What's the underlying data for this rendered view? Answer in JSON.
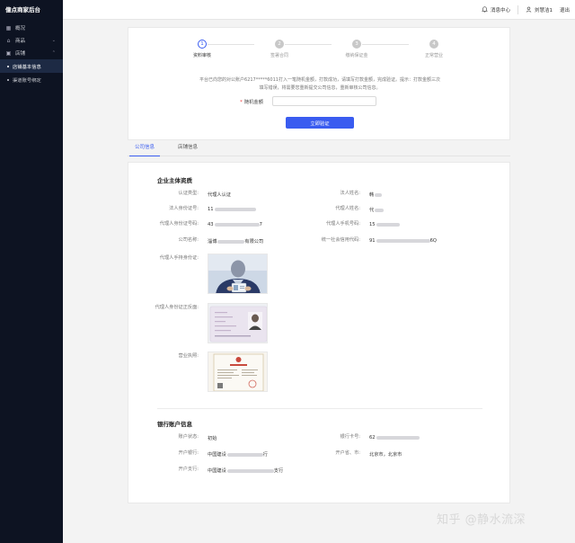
{
  "sidebar": {
    "brand": "億点商家后台",
    "items": [
      {
        "label": "概况",
        "icon": "grid-icon"
      },
      {
        "label": "商品",
        "icon": "home-icon"
      },
      {
        "label": "店铺",
        "icon": "store-icon"
      }
    ],
    "subitems": [
      {
        "label": "店铺基本信息",
        "active": true
      },
      {
        "label": "渠道账号绑定",
        "active": false
      }
    ]
  },
  "header": {
    "messages": "消息中心",
    "user": "刘慧洁1",
    "logout": "退出"
  },
  "steps": [
    {
      "num": "1",
      "label": "资料审核",
      "active": true
    },
    {
      "num": "2",
      "label": "签署合同",
      "active": false
    },
    {
      "num": "3",
      "label": "缴纳保证金",
      "active": false
    },
    {
      "num": "4",
      "label": "正常营业",
      "active": false
    }
  ],
  "notice": {
    "line1": "平台已向您的对公账户6217*****6011打入一笔随机金额，打款成功，请填写打款金额，完成验证。提示：打款金额三次",
    "line2": "填写错误，将需要您重新提交公司信息，重新审核公司信息。"
  },
  "amount": {
    "label": "随机金额",
    "value": ""
  },
  "verify_button": "立即验证",
  "tabs": [
    "公司信息",
    "店铺信息"
  ],
  "company": {
    "title": "企业主体资质",
    "auth_type_label": "认证类型:",
    "auth_type": "代理人认证",
    "legal_name_label": "法人姓名:",
    "legal_name": "韩",
    "legal_id_label": "法人身份证号:",
    "legal_id": "11",
    "agent_name_label": "代理人姓名:",
    "agent_name": "代",
    "agent_id_label": "代理人身份证号码:",
    "agent_id_start": "43",
    "agent_id_end": "7",
    "agent_phone_label": "代理人手机号码:",
    "agent_phone": "15",
    "company_name_label": "公司名称:",
    "company_name_start": "淄博",
    "company_name_end": "有限公司",
    "credit_code_label": "统一社会信用代码:",
    "credit_code_start": "91",
    "credit_code_end": "6Q",
    "handheld_label": "代理人手持身份证:",
    "id_front_label": "代理人身份证正反面:",
    "license_label": "营业执照:"
  },
  "bank": {
    "title": "银行账户信息",
    "status_label": "账户状态:",
    "status": "初始",
    "card_label": "银行卡号:",
    "card": "62",
    "bank_label": "开户银行:",
    "bank_start": "中国建设",
    "bank_end": "行",
    "city_label": "开户省、市:",
    "city": "北京市，北京市",
    "branch_label": "开户支行:",
    "branch_start": "中国建设",
    "branch_end": "支行"
  },
  "watermark": "知乎 @静水流深"
}
